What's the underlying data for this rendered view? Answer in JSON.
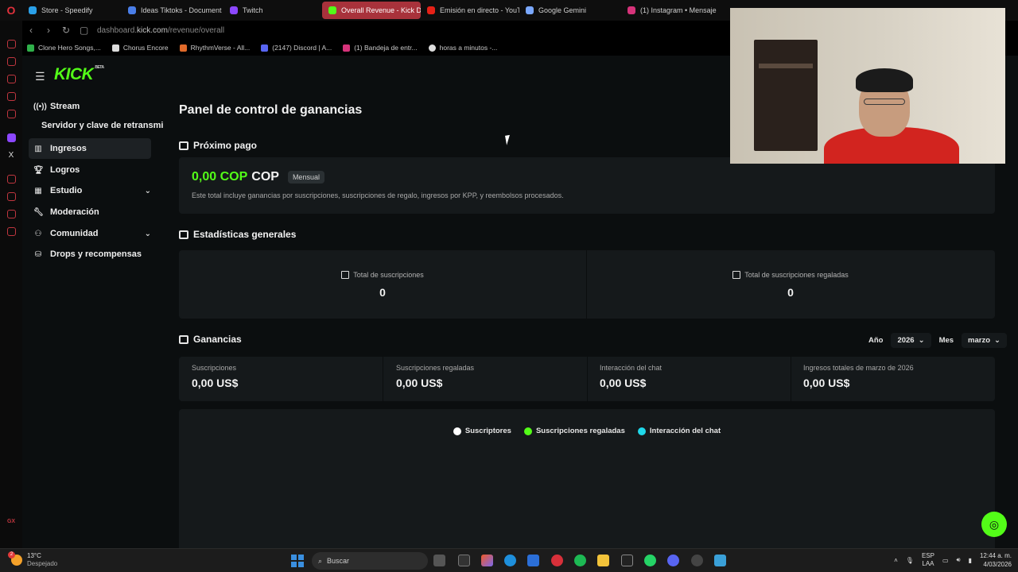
{
  "browser": {
    "tabs": [
      {
        "label": "Store - Speedify",
        "color": "#2aa0e8"
      },
      {
        "label": "Ideas Tiktoks - Document",
        "color": "#4a7ee8"
      },
      {
        "label": "Twitch",
        "color": "#8c47ff"
      },
      {
        "label": "Overall Revenue - Kick D",
        "color": "#53fc18",
        "active": true
      },
      {
        "label": "Emisión en directo - YouTu",
        "color": "#e62117"
      },
      {
        "label": "Google Gemini",
        "color": "#7aa8ff"
      },
      {
        "label": "(1) Instagram • Mensajes",
        "color": "#d6337a"
      }
    ],
    "url_prefix": "dashboard.",
    "url_domain": "kick.com",
    "url_path": "/revenue/overall",
    "bookmarks": [
      {
        "label": "Clone Hero Songs,...",
        "color": "#2fb04a"
      },
      {
        "label": "Chorus Encore",
        "color": "#dddddd"
      },
      {
        "label": "RhythmVerse - All...",
        "color": "#e06a2a"
      },
      {
        "label": "(2147) Discord | A...",
        "color": "#5865f2"
      },
      {
        "label": "(1) Bandeja de entr...",
        "color": "#d6337a"
      },
      {
        "label": "horas a minutos -...",
        "color": "#dddddd"
      }
    ]
  },
  "app": {
    "logo": "KICK",
    "logo_badge": "BETA",
    "nav": [
      {
        "label": "Stream",
        "icon": "broadcast-icon"
      },
      {
        "label": "Servidor y clave de retransmi",
        "icon": ""
      },
      {
        "label": "Ingresos",
        "icon": "chart-icon",
        "active": true
      },
      {
        "label": "Logros",
        "icon": "trophy-icon"
      },
      {
        "label": "Estudio",
        "icon": "studio-icon",
        "expandable": true
      },
      {
        "label": "Moderación",
        "icon": "wrench-icon"
      },
      {
        "label": "Comunidad",
        "icon": "community-icon",
        "expandable": true
      },
      {
        "label": "Drops y recompensas",
        "icon": "drops-icon"
      }
    ],
    "page_title": "Panel de control de ganancias",
    "next_payout": {
      "heading": "Próximo pago",
      "amount": "0,00 COP",
      "currency": "COP",
      "period": "Mensual",
      "note": "Este total incluye ganancias por suscripciones, suscripciones de regalo, ingresos por KPP, y reembolsos procesados."
    },
    "general_stats": {
      "heading": "Estadísticas generales",
      "items": [
        {
          "label": "Total de suscripciones",
          "value": "0"
        },
        {
          "label": "Total de suscripciones regaladas",
          "value": "0"
        }
      ]
    },
    "earnings": {
      "heading": "Ganancias",
      "year_label": "Año",
      "year_value": "2026",
      "month_label": "Mes",
      "month_value": "marzo",
      "cells": [
        {
          "label": "Suscripciones",
          "value": "0,00 US$"
        },
        {
          "label": "Suscripciones regaladas",
          "value": "0,00 US$"
        },
        {
          "label": "Interacción del chat",
          "value": "0,00 US$"
        },
        {
          "label": "Ingresos totales de marzo de 2026",
          "value": "0,00 US$"
        }
      ],
      "legend": [
        {
          "label": "Suscriptores",
          "color": "#ffffff"
        },
        {
          "label": "Suscripciones regaladas",
          "color": "#53fc18"
        },
        {
          "label": "Interacción del chat",
          "color": "#1fd8ea"
        }
      ]
    }
  },
  "taskbar": {
    "temp": "13°C",
    "weather": "Despejado",
    "weather_badge": "2",
    "search_placeholder": "Buscar",
    "lang_1": "ESP",
    "lang_2": "LAA",
    "time": "12:44 a. m.",
    "date": "4/03/2026"
  }
}
